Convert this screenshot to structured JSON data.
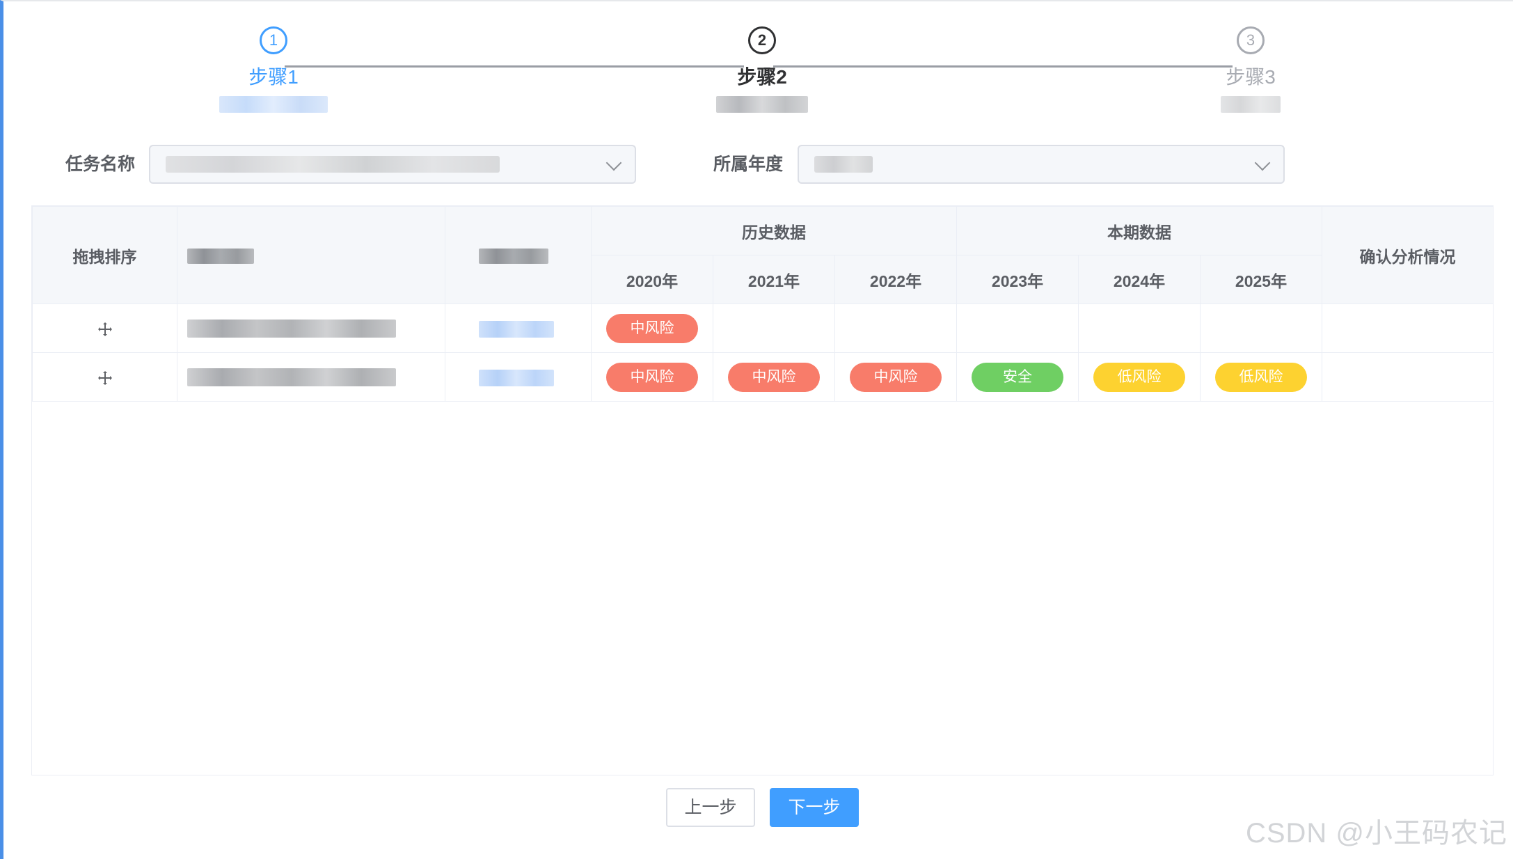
{
  "steps": [
    {
      "number": "1",
      "title": "步骤1",
      "status": "finished"
    },
    {
      "number": "2",
      "title": "步骤2",
      "status": "current"
    },
    {
      "number": "3",
      "title": "步骤3",
      "status": "waiting"
    }
  ],
  "form": {
    "task_label": "任务名称",
    "year_label": "所属年度"
  },
  "table": {
    "drag_header": "拖拽排序",
    "history_header": "历史数据",
    "current_header": "本期数据",
    "confirm_header": "确认分析情况",
    "years": [
      "2020年",
      "2021年",
      "2022年",
      "2023年",
      "2024年",
      "2025年"
    ],
    "rows": [
      {
        "results": [
          "中风险",
          "",
          "",
          "",
          "",
          ""
        ]
      },
      {
        "results": [
          "中风险",
          "中风险",
          "中风险",
          "安全",
          "低风险",
          "低风险"
        ]
      }
    ]
  },
  "risk_colors": {
    "中风险": "#f87c6a",
    "安全": "#6fcf63",
    "低风险": "#fdd230"
  },
  "buttons": {
    "prev": "上一步",
    "next": "下一步"
  },
  "watermark": "CSDN @小王码农记"
}
